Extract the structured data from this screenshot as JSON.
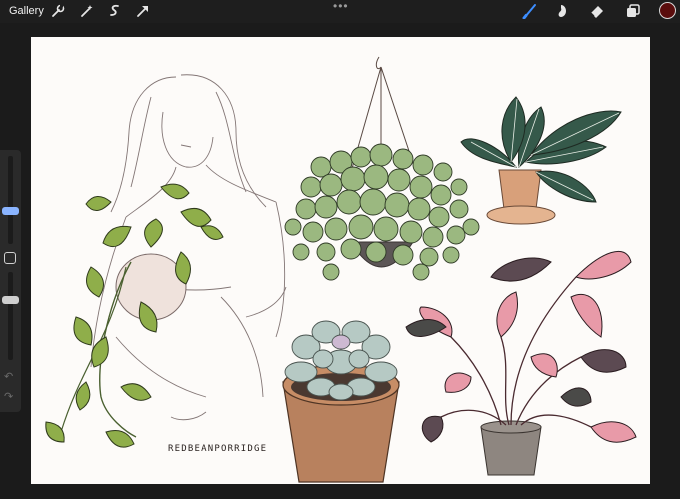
{
  "toolbar": {
    "gallery_label": "Gallery",
    "left_tools": [
      "wrench-icon",
      "magic-wand-icon",
      "selection-icon",
      "transform-arrow-icon"
    ],
    "more_label": "•••",
    "right_tools": [
      "brush-icon",
      "smudge-icon",
      "eraser-icon",
      "layers-icon"
    ],
    "active_tool": "brush-icon",
    "current_color": "#5a0c0c",
    "accent_color": "#3d8eff"
  },
  "sidebar": {
    "size_slider": 0.36,
    "opacity_slider": 0.7,
    "undo_glyph": "↶",
    "redo_glyph": "↷"
  },
  "canvas": {
    "signature": "REDBEANPORRIDGE"
  }
}
